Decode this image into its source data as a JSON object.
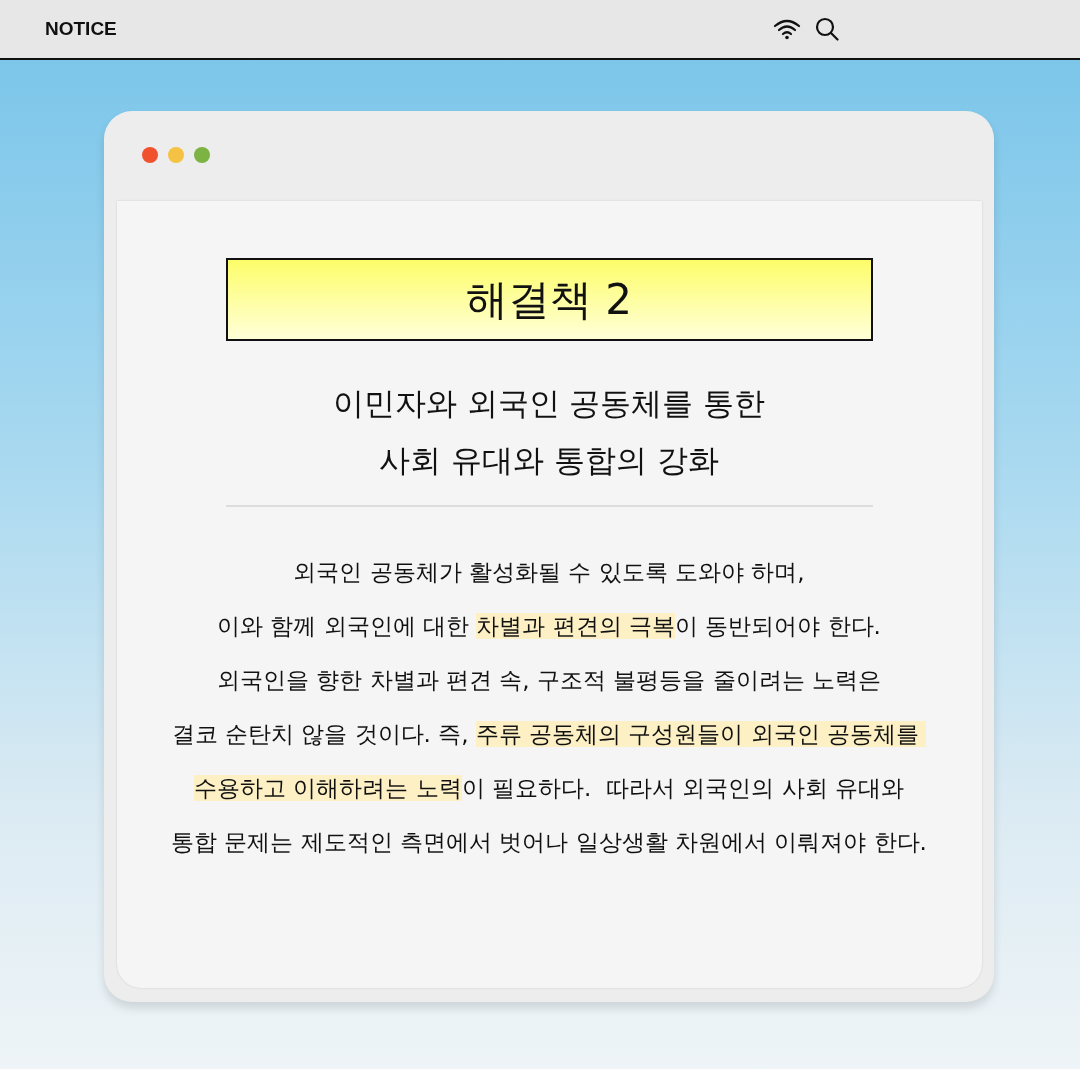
{
  "top_bar": {
    "title": "NOTICE"
  },
  "window": {
    "traffic_lights": [
      {
        "color": "#f0522e"
      },
      {
        "color": "#f6c244"
      },
      {
        "color": "#7cb342"
      }
    ],
    "heading": "해결책 2",
    "subtitle": [
      "이민자와 외국인 공동체를 통한",
      "사회 유대와 통합의 강화"
    ],
    "body": [
      [
        {
          "text": "외국인 공동체가 활성화될 수 있도록 도와야 하며,",
          "highlighted": false
        }
      ],
      [
        {
          "text": "이와 함께 외국인에 대한 ",
          "highlighted": false
        },
        {
          "text": "차별과 편견의 극복",
          "highlighted": true
        },
        {
          "text": "이 동반되어야 한다.",
          "highlighted": false
        }
      ],
      [
        {
          "text": "외국인을 향한 차별과 편견 속, 구조적 불평등을 줄이려는 노력은",
          "highlighted": false
        }
      ],
      [
        {
          "text": "결코 순탄치 않을 것이다. 즉, ",
          "highlighted": false
        },
        {
          "text": "주류 공동체의 구성원들이 외국인 공동체를 ",
          "highlighted": true
        }
      ],
      [
        {
          "text": "수용하고 이해하려는 노력",
          "highlighted": true
        },
        {
          "text": "이 필요하다.  따라서 외국인의 사회 유대와",
          "highlighted": false
        }
      ],
      [
        {
          "text": "통합 문제는 제도적인 측면에서 벗어나 일상생활 차원에서 이뤄져야 한다.",
          "highlighted": false
        }
      ]
    ]
  }
}
